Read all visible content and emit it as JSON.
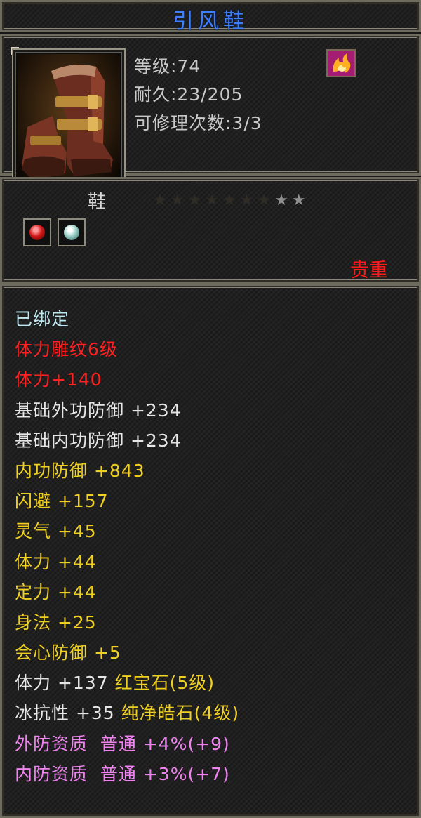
{
  "item": {
    "name": "引风鞋",
    "level": "等级:74",
    "durability": "耐久:23/205",
    "repair_count": "可修理次数:3/3",
    "type": "鞋",
    "stars": {
      "total": 9,
      "lit": 2
    },
    "rarity": "贵重"
  },
  "attributes": [
    {
      "text": "已绑定",
      "color": "#bfe7f0"
    },
    {
      "text": "体力雕纹6级",
      "color": "#ff2020"
    },
    {
      "text": "体力+140",
      "color": "#ff2020"
    },
    {
      "text": "基础外功防御 +234",
      "color": "#e6e6e6"
    },
    {
      "text": "基础内功防御 +234",
      "color": "#e6e6e6"
    },
    {
      "text": "内功防御 +843",
      "color": "#f0d020"
    },
    {
      "text": "闪避 +157",
      "color": "#f0d020"
    },
    {
      "text": "灵气 +45",
      "color": "#f0d020"
    },
    {
      "text": "体力 +44",
      "color": "#f0d020"
    },
    {
      "text": "定力 +44",
      "color": "#f0d020"
    },
    {
      "text": "身法 +25",
      "color": "#f0d020"
    },
    {
      "text": "会心防御 +5",
      "color": "#f0d020"
    },
    {
      "parts": [
        {
          "text": "体力 +137 ",
          "color": "#e6e6e6"
        },
        {
          "text": "红宝石(5级)",
          "color": "#f0d020"
        }
      ]
    },
    {
      "parts": [
        {
          "text": "冰抗性 +35 ",
          "color": "#e6e6e6"
        },
        {
          "text": "纯净皓石(4级)",
          "color": "#f0d020"
        }
      ]
    },
    {
      "text": "外防资质  普通 +4%(+9)",
      "color": "#ee82ee"
    },
    {
      "text": "内防资质  普通 +3%(+7)",
      "color": "#ee82ee"
    }
  ],
  "icons": {
    "item_icon": "boots-icon",
    "special_icon": "flame-skill-icon",
    "gem_slot_1": "red-gem-icon",
    "gem_slot_2": "white-gem-icon"
  }
}
